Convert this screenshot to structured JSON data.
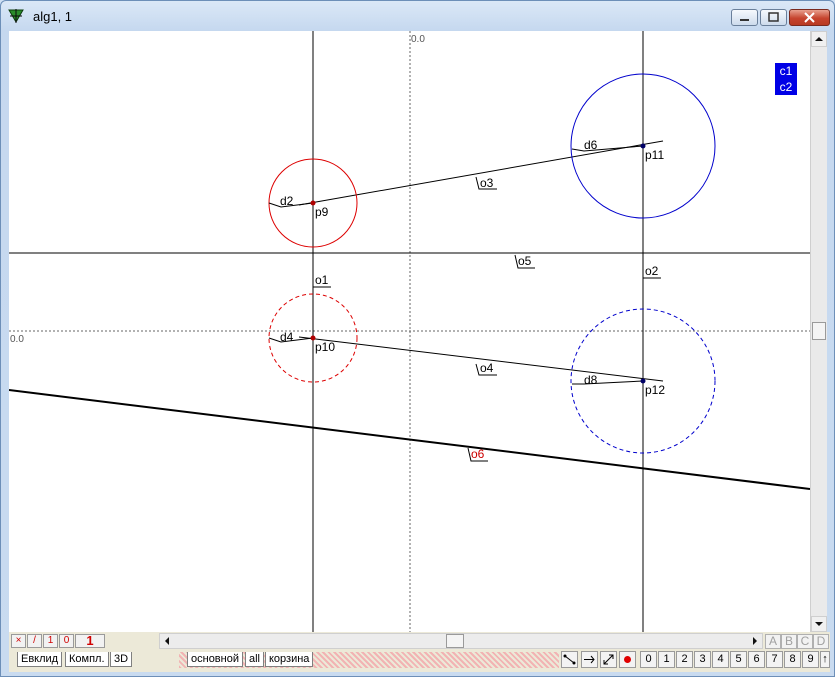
{
  "window": {
    "title": "alg1, 1"
  },
  "canvas": {
    "axis_label_top": "0.0",
    "axis_label_left": "0.0",
    "labels": {
      "p9": "p9",
      "p10": "p10",
      "p11": "p11",
      "p12": "p12",
      "o1": "o1",
      "o2": "o2",
      "o3": "o3",
      "o4": "o4",
      "o5": "o5",
      "o6": "o6",
      "d2": "d2",
      "d4": "d4",
      "d6": "d6",
      "d8": "d8"
    },
    "colors": {
      "red_circle": "#dd0000",
      "blue_circle": "#0000cc",
      "o6_label": "#cc0000"
    }
  },
  "layers": [
    "c1",
    "c2"
  ],
  "bottom": {
    "tools": [
      "×",
      "/",
      "1",
      "0"
    ],
    "layer_num": "1",
    "layer_buttons": [
      "A",
      "B",
      "C",
      "D"
    ],
    "tabs_left": [
      "Евклид",
      "Компл.",
      "3D"
    ],
    "tabs_right": [
      "основной",
      "all",
      "корзина"
    ],
    "number_buttons": [
      "0",
      "1",
      "2",
      "3",
      "4",
      "5",
      "6",
      "7",
      "8",
      "9",
      "↑"
    ],
    "draw_buttons": [
      "segment-tool",
      "arrow-tool",
      "diagonal-tool",
      "point-tool"
    ]
  }
}
